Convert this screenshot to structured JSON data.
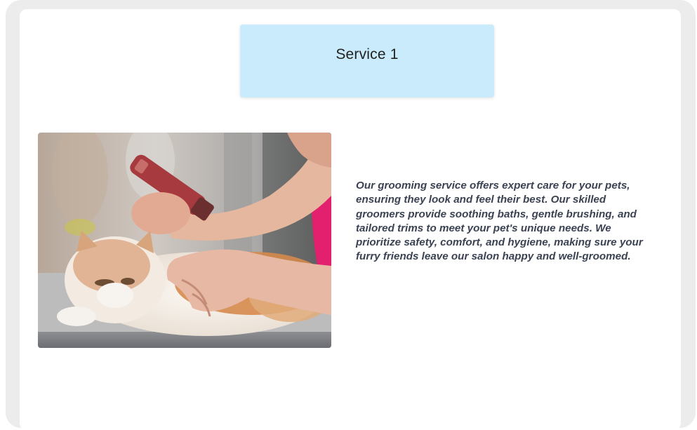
{
  "service": {
    "title": "Service 1",
    "image_subject": "cat-grooming-photo",
    "description": "Our grooming service offers expert care for your pets, ensuring they look and feel their best. Our skilled groomers provide soothing baths, gentle brushing, and tailored trims to meet your pet's unique needs. We prioritize safety, comfort, and hygiene, making sure your furry friends leave our salon happy and well-groomed."
  },
  "colors": {
    "tile_background": "#c9ebfb",
    "description_text": "#3b4252",
    "frame": "#ececec"
  }
}
